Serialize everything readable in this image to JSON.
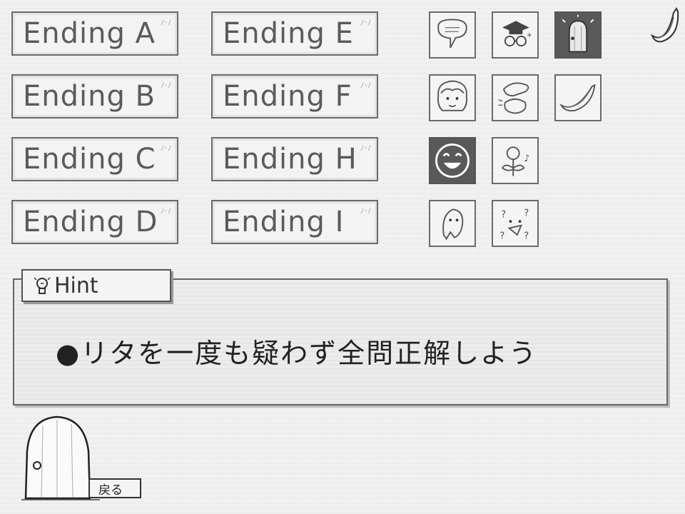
{
  "endings": [
    {
      "label": "Ending A"
    },
    {
      "label": "Ending B"
    },
    {
      "label": "Ending C"
    },
    {
      "label": "Ending D"
    },
    {
      "label": "Ending E"
    },
    {
      "label": "Ending F"
    },
    {
      "label": "Ending H"
    },
    {
      "label": "Ending I"
    }
  ],
  "icons": [
    {
      "name": "speech-bubble-icon"
    },
    {
      "name": "graduate-glasses-icon"
    },
    {
      "name": "door-glowing-icon",
      "selected": true
    },
    {
      "name": "girl-portrait-icon"
    },
    {
      "name": "hand-patting-icon"
    },
    {
      "name": "banana-icon"
    },
    {
      "name": "grinning-face-icon",
      "selected": true
    },
    {
      "name": "singing-flower-icon"
    },
    {
      "name": "ghost-icon"
    },
    {
      "name": "confused-face-icon"
    }
  ],
  "hint": {
    "tab_label": "Hint",
    "text": "●リタを一度も疑わず全問正解しよう"
  },
  "back_button": {
    "label": "戻る"
  },
  "colors": {
    "background": "#f1f1f1",
    "border": "#6a6a6a",
    "selected_tile": "#595959"
  }
}
